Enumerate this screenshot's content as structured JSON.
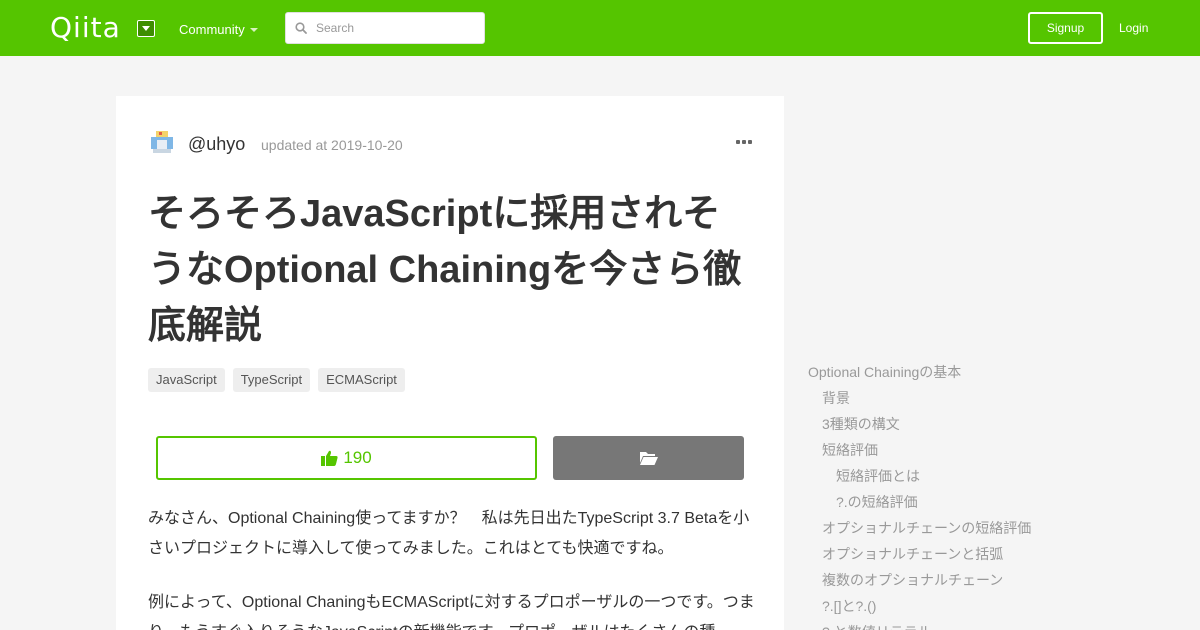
{
  "header": {
    "logo": "Qiita",
    "community_label": "Community",
    "search_placeholder": "Search",
    "signup_label": "Signup",
    "login_label": "Login"
  },
  "article": {
    "author": "@uhyo",
    "updated": "updated at 2019-10-20",
    "title": "そろそろJavaScriptに採用されそうなOptional Chainingを今さら徹底解説",
    "tags": [
      "JavaScript",
      "TypeScript",
      "ECMAScript"
    ],
    "like_count": "190",
    "paragraphs": [
      "みなさん、Optional Chaining使ってますか？　私は先日出たTypeScript 3.7 Betaを小さいプロジェクトに導入して使ってみました。これはとても快適ですね。",
      "例によって、Optional ChaningもECMAScriptに対するプロポーザルの一つです。つまり、もうすぐ入りそうなJavaScriptの新機能です。プロポーザルはたくさんの種"
    ]
  },
  "toc": [
    {
      "label": "Optional Chainingの基本",
      "level": 1
    },
    {
      "label": "背景",
      "level": 2
    },
    {
      "label": "3種類の構文",
      "level": 2
    },
    {
      "label": "短絡評価",
      "level": 2
    },
    {
      "label": "短絡評価とは",
      "level": 3
    },
    {
      "label": "?.の短絡評価",
      "level": 3
    },
    {
      "label": "オプショナルチェーンの短絡評価",
      "level": 2
    },
    {
      "label": "オプショナルチェーンと括弧",
      "level": 2
    },
    {
      "label": "複数のオプショナルチェーン",
      "level": 2
    },
    {
      "label": "?.[]と?.()",
      "level": 2
    },
    {
      "label": "?.と数値リテラル",
      "level": 2
    }
  ],
  "colors": {
    "brand": "#55c500",
    "stock_button": "#777777"
  }
}
